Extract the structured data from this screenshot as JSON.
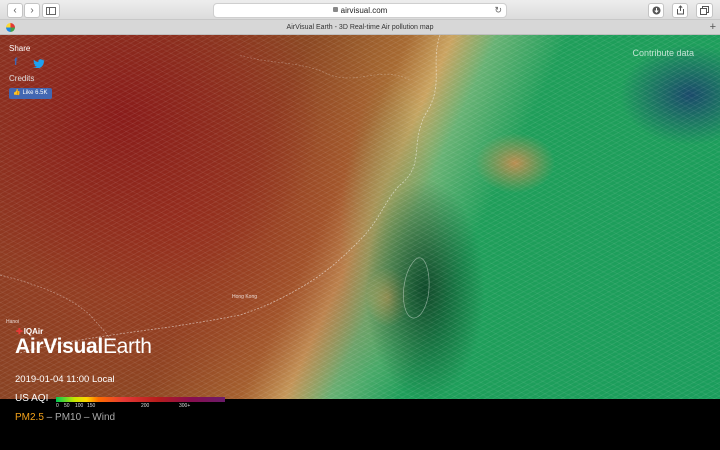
{
  "browser": {
    "url": "airvisual.com",
    "tab_title": "AirVisual Earth - 3D Real-time Air pollution map",
    "back_glyph": "‹",
    "forward_glyph": "›",
    "new_tab_glyph": "+"
  },
  "map": {
    "share_label": "Share",
    "credits_label": "Credits",
    "like_label": "Like 6.5K",
    "contribute_label": "Contribute data",
    "place_labels": [
      "Hanoi",
      "Hong Kong"
    ]
  },
  "brand": {
    "logo_text": "IQAir",
    "title_strong": "AirVisual",
    "title_light": "Earth"
  },
  "status": {
    "datetime": "2019-01-04 11:00 Local"
  },
  "legend": {
    "label": "US AQI",
    "ticks": [
      "0",
      "50",
      "100",
      "150",
      "200",
      "300+"
    ]
  },
  "layers": {
    "pm25": "PM2.5",
    "sep1": " – ",
    "pm10": "PM10",
    "sep2": " – ",
    "wind": "Wind",
    "active": "PM2.5"
  },
  "colors": {
    "accent_active_layer": "#f4a21b",
    "facebook": "#4267b2",
    "twitter": "#1da1f2"
  }
}
